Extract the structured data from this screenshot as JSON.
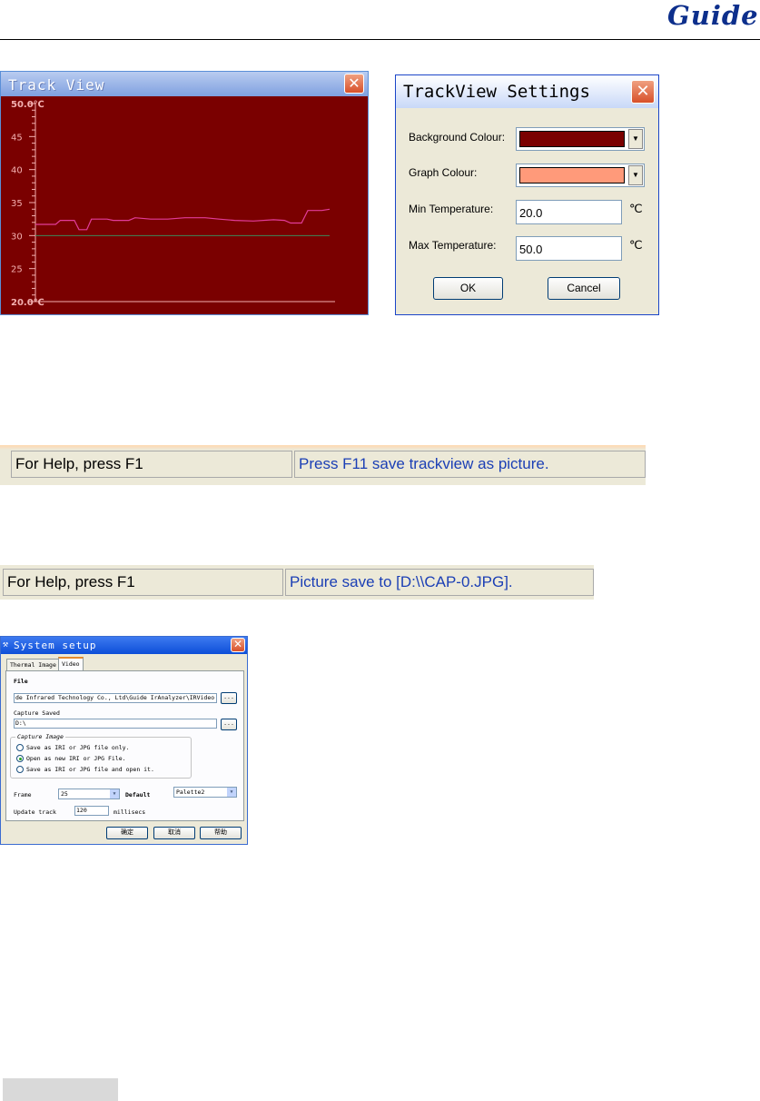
{
  "header": {
    "logo": "Guide"
  },
  "trackview": {
    "title": "Track View",
    "close_glyph": "✕",
    "plot": {
      "y_max_label": "50.0℃",
      "y_min_label": "20.0℃",
      "tick_labels": [
        "45",
        "40",
        "35",
        "30",
        "25"
      ],
      "ylim": [
        20,
        50
      ],
      "reference_line": 30,
      "series": [
        {
          "x": 0,
          "y": 31.7
        },
        {
          "x": 13,
          "y": 31.7
        },
        {
          "x": 16,
          "y": 32.3
        },
        {
          "x": 25,
          "y": 32.3
        },
        {
          "x": 28,
          "y": 30.9
        },
        {
          "x": 33,
          "y": 30.9
        },
        {
          "x": 36,
          "y": 32.5
        },
        {
          "x": 46,
          "y": 32.5
        },
        {
          "x": 50,
          "y": 32.3
        },
        {
          "x": 60,
          "y": 32.3
        },
        {
          "x": 64,
          "y": 32.7
        },
        {
          "x": 74,
          "y": 32.5
        },
        {
          "x": 85,
          "y": 32.5
        },
        {
          "x": 96,
          "y": 32.7
        },
        {
          "x": 109,
          "y": 32.7
        },
        {
          "x": 118,
          "y": 32.5
        },
        {
          "x": 128,
          "y": 32.3
        },
        {
          "x": 140,
          "y": 32.2
        },
        {
          "x": 153,
          "y": 32.4
        },
        {
          "x": 160,
          "y": 32.3
        },
        {
          "x": 164,
          "y": 31.9
        },
        {
          "x": 171,
          "y": 31.9
        },
        {
          "x": 175,
          "y": 33.8
        },
        {
          "x": 184,
          "y": 33.8
        },
        {
          "x": 189,
          "y": 34.0
        }
      ],
      "colors": {
        "background": "#7a0000",
        "line": "#e23c9a",
        "reference": "#3c8a5a",
        "axis": "#f3b0b0"
      }
    }
  },
  "settings": {
    "title": "TrackView Settings",
    "close_glyph": "✕",
    "background_colour_label": "Background Colour:",
    "graph_colour_label": "Graph Colour:",
    "min_temp_label": "Min Temperature:",
    "max_temp_label": "Max Temperature:",
    "min_temp_value": "20.0",
    "max_temp_value": "50.0",
    "unit": "℃",
    "dropdown_glyph": "▼",
    "ok_label": "OK",
    "cancel_label": "Cancel",
    "colors": {
      "background_colour": "#7a0000",
      "graph_colour": "#ff9a7a"
    }
  },
  "statusbar1": {
    "help": "For Help, press F1",
    "message": "Press F11 save trackview as picture."
  },
  "statusbar2": {
    "help": "For Help, press F1",
    "message": "Picture save to [D:\\\\CAP-0.JPG]."
  },
  "syssetup": {
    "title": "System setup",
    "title_icon": "⚒",
    "close_glyph": "✕",
    "tabs": [
      "Thermal Image",
      "Video"
    ],
    "file_label": "File",
    "file_value": "de Infrared Technology Co., Ltd\\Guide IrAnalyzer\\IRVideo",
    "browse_label": "...",
    "capture_saved_label": "Capture Saved",
    "capture_saved_value": "D:\\",
    "capture_group_title": "Capture Image",
    "options": [
      "Save as IRI or JPG file only.",
      "Open as new IRI or JPG File.",
      "Save as IRI or JPG file and open it."
    ],
    "frame_label": "Frame",
    "frame_value": "25",
    "default_label": "Default",
    "default_value": "Palette2",
    "update_track_label": "Update track",
    "update_track_value": "120",
    "update_track_unit": "millisecs",
    "dropdown_glyph": "▼",
    "ok_label": "确定",
    "cancel_label": "取消",
    "help_label": "帮助"
  }
}
